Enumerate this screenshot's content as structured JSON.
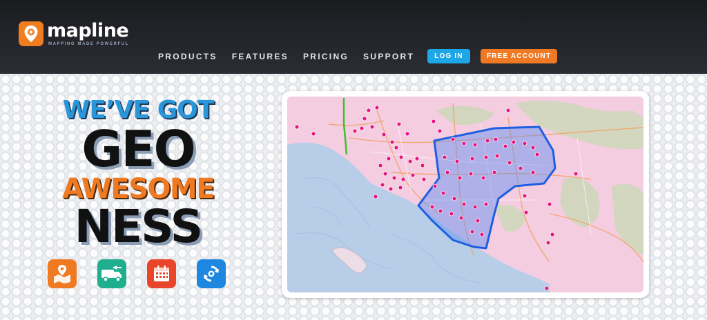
{
  "brand": {
    "name": "mapline",
    "tagline": "MAPPING MADE POWERFUL",
    "color": "#f07d20"
  },
  "nav": {
    "links": [
      "PRODUCTS",
      "FEATURES",
      "PRICING",
      "SUPPORT"
    ],
    "login_label": "LOG IN",
    "free_account_label": "FREE ACCOUNT"
  },
  "hero": {
    "line1": "WE’VE GOT",
    "line2": "GEO",
    "line3": "AWESOME",
    "line4": "NESS"
  },
  "feature_icons": [
    "map-route-icon",
    "delivery-truck-icon",
    "calendar-icon",
    "sync-icon"
  ],
  "colors": {
    "accent_blue": "#1ea7e6",
    "accent_orange": "#f07a24",
    "pin": "#e6157f",
    "territory": "#1d5fe0"
  }
}
